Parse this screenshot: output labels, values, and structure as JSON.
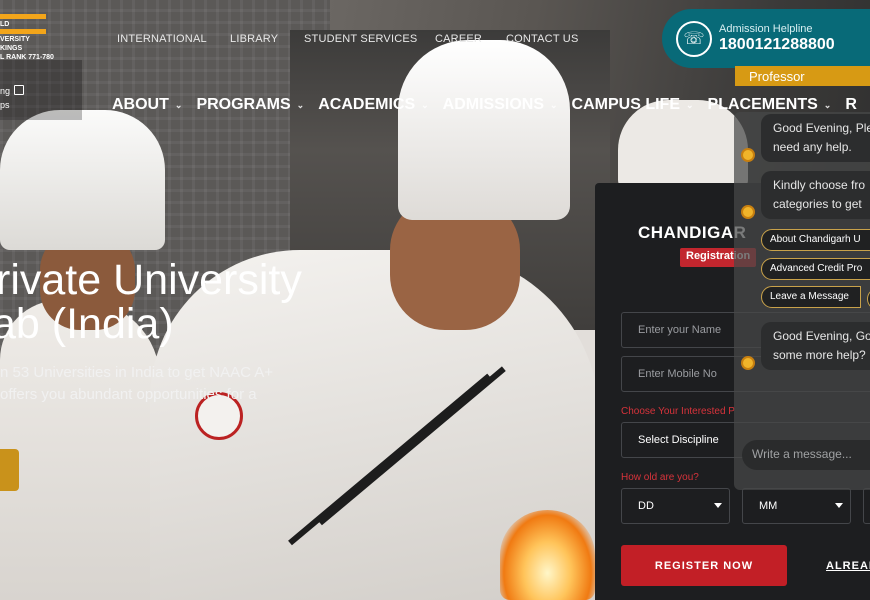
{
  "logo": {
    "lines": [
      "LD",
      "VERSITY",
      "KINGS",
      "L RANK 771-780"
    ]
  },
  "side_link": {
    "line1": "ng",
    "line2": "ps"
  },
  "top_links": [
    "INTERNATIONAL",
    "LIBRARY",
    "STUDENT SERVICES",
    "CAREER",
    "CONTACT US"
  ],
  "helpline": {
    "label": "Admission Helpline",
    "number": "1800121288800",
    "icon": "phone-icon"
  },
  "professor_tag": "Professor",
  "nav": [
    "ABOUT",
    "PROGRAMS",
    "ACADEMICS",
    "ADMISSIONS",
    "CAMPUS LIFE",
    "PLACEMENTS",
    "R"
  ],
  "hero": {
    "line1": "rivate University",
    "line2": "ab (India)",
    "para1": "n 53 Universities in India to get NAAC A+",
    "para2": "offers you abundant opportunities for a"
  },
  "form": {
    "title": "CHANDIGAR",
    "badge": "Registration",
    "name_placeholder": "Enter your Name",
    "mobile_placeholder": "Enter Mobile No",
    "interest_label": "Choose Your Interested P",
    "discipline": "Select Discipline",
    "age_label": "How old are you?",
    "dd": "DD",
    "mm": "MM",
    "register": "REGISTER NOW",
    "already": "ALREAD"
  },
  "chat": {
    "bubble1_l1": "Good Evening, Ple",
    "bubble1_l2": "need any help.",
    "bubble2_l1": "Kindly choose fro",
    "bubble2_l2": "categories to get",
    "chips": [
      "About Chandigarh U",
      "Advanced Credit Pro",
      "Leave a Message"
    ],
    "bubble3_l1": "Good Evening, Go",
    "bubble3_l2": "some more help?",
    "input_placeholder": "Write a message..."
  }
}
